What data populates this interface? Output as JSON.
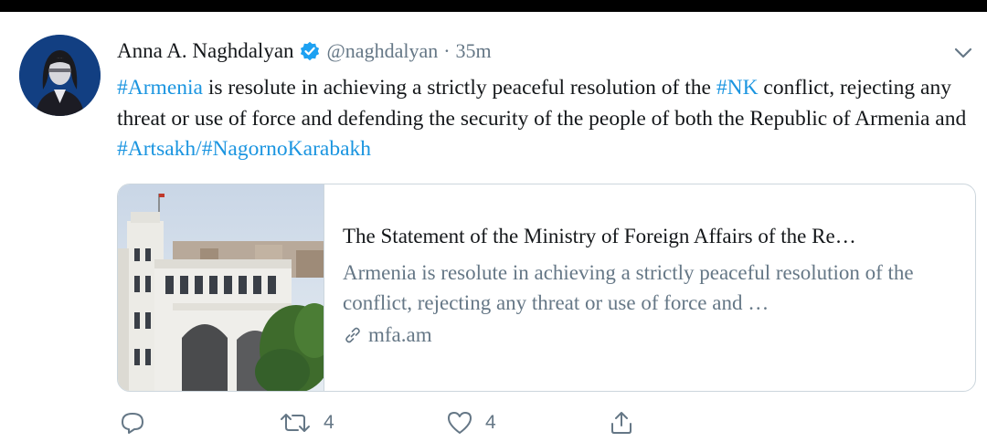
{
  "tweet": {
    "author_name": "Anna A. Naghdalyan",
    "handle": "@naghdalyan",
    "separator": "·",
    "time": "35m",
    "verified": true,
    "text": {
      "hashtag_armenia": "#Armenia",
      "part1": " is resolute in achieving a strictly peaceful resolution of the ",
      "hashtag_nk": "#NK",
      "part2": " conflict, rejecting any threat or use of force and defending the security of the people of both the Republic of Armenia and ",
      "hashtag_artsakh": "#Artsakh",
      "slash": "/",
      "hashtag_nagorno": "#NagornoKarabakh"
    }
  },
  "card": {
    "title": "The Statement of the Ministry of Foreign Affairs of the Re…",
    "description": "Armenia is resolute in achieving a strictly peaceful resolution of the conflict, rejecting any threat or use of force and …",
    "domain": "mfa.am"
  },
  "actions": {
    "reply_count": "",
    "retweet_count": "4",
    "like_count": "4"
  },
  "icons": {
    "verified": "verified-badge-icon",
    "caret": "chevron-down-icon",
    "link": "link-icon",
    "reply": "reply-icon",
    "retweet": "retweet-icon",
    "like": "heart-icon",
    "share": "share-icon"
  },
  "colors": {
    "accent": "#1b95e0",
    "secondary_text": "#657786",
    "border": "#ccd6dd",
    "verified": "#1da1f2"
  }
}
